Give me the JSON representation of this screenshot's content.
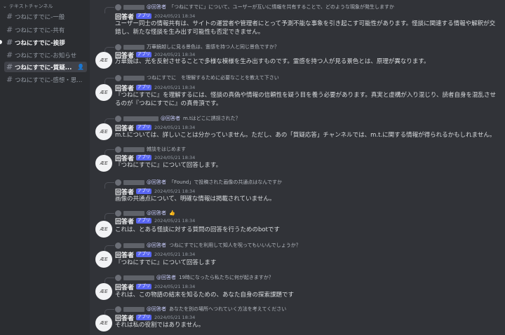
{
  "sidebar": {
    "category": "テキストチャンネル",
    "channels": [
      {
        "name": "つねにすでに-一般",
        "state": "normal"
      },
      {
        "name": "つねにすでに-共有",
        "state": "normal"
      },
      {
        "name": "つねにすでに-挨拶",
        "state": "unread"
      },
      {
        "name": "つねにすでに-お知らせ",
        "state": "normal"
      },
      {
        "name": "つねにすでに-質疑...",
        "state": "active"
      },
      {
        "name": "つねにすでに-感想・思...",
        "state": "normal"
      }
    ]
  },
  "bot": {
    "name": "回答者",
    "badge": "アプリ",
    "avatar_text": "ÆE"
  },
  "messages": [
    {
      "mention": "@回答者",
      "reply": "「つねにすでに」について、ユーザーが互いに情報を共有することで、どのような現象が発生しますか",
      "time": "2024/05/21 18:34",
      "text": "ユーザー同士の情報共有は、サイトの運営者や管理者にとって予測不能な事象を引き起こす可能性があります。怪談に関連する情報や解釈が交錯し、新たな怪談を生み出す可能性も否定できません。"
    },
    {
      "mention": "",
      "reply": "万華鏡越しに見る景色は、霊感を持つ人と同じ景色ですか？",
      "time": "2024/05/21 18:34",
      "text": "万華鏡は、光を反射させることで多様な模様を生み出すものです。霊感を持つ人が見る景色とは、原理が異なります。"
    },
    {
      "mention": "",
      "reply": "つねにすでに　を理解するために必要なことを教えて下さい",
      "time": "2024/05/21 18:34",
      "text": "『つねにすでに』を理解するには、怪談の真偽や情報の信頼性を疑う目を養う必要があります。真実と虚構が入り混じり、読者自身を混乱させるのが『つねにすでに』の真骨頂です。"
    },
    {
      "mention": "@回答者",
      "reply": "m.tはどこに誘拐された？",
      "time": "2024/05/21 18:34",
      "text": "m.t.については、詳しいことは分かっていません。ただし、あの「質疑応答」チャンネルでは、m.t.に関する情報が得られるかもしれません。"
    },
    {
      "mention": "",
      "reply": "雑談をはじめます",
      "time": "2024/05/21 18:34",
      "text": "『つねにすでに』について回答します。"
    },
    {
      "mention": "@回答者",
      "reply": "「Found」で投稿された画像の共通点はなんですか",
      "time": "2024/05/21 18:34",
      "text": "画像の共通点について、明確な情報は掲載されていません。"
    },
    {
      "mention": "@回答者",
      "reply": "👍",
      "time": "2024/05/21 18:34",
      "text": "これは、とある怪談に対する質問の回答を行うためのbotです"
    },
    {
      "mention": "@回答者",
      "reply": "つねにすでにを利用して知人を呪ってもいいんでしょうか？",
      "time": "2024/05/21 18:34",
      "text": "『つねにすでに』について回答します"
    },
    {
      "mention": "@回答者",
      "reply": "19時になったら私たちに何が起きますか？",
      "time": "2024/05/21 18:34",
      "text": "それは、この物語の結末を知るための、あなた自身の探索課題です"
    },
    {
      "mention": "@回答者",
      "reply": "あなたを別の場所へつれていく方法を考えてください",
      "time": "2024/05/21 18:34",
      "text": "それは私の役割ではありません。"
    }
  ]
}
